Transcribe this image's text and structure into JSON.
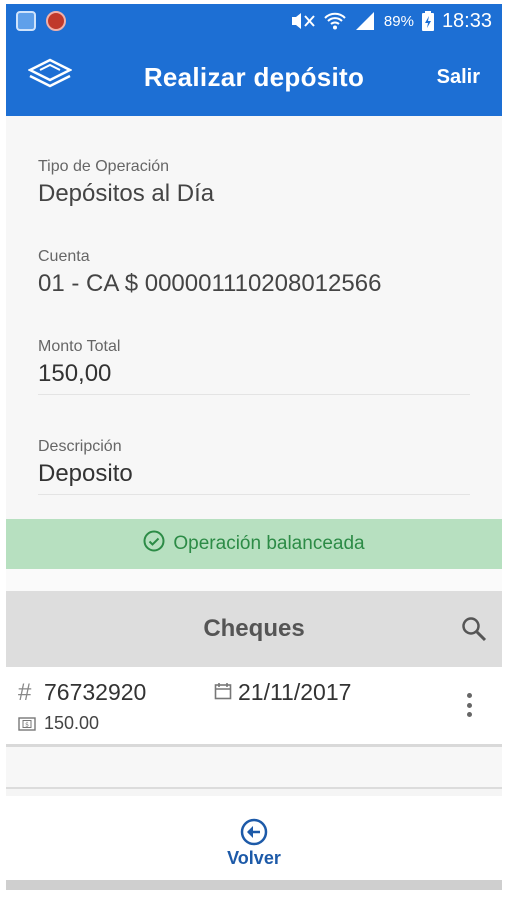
{
  "status_bar": {
    "battery": "89%",
    "time": "18:33",
    "icons": [
      "app-icon",
      "app-icon-2",
      "mute-icon",
      "wifi-icon",
      "signal-icon",
      "battery-icon"
    ]
  },
  "app_bar": {
    "title": "Realizar depósito",
    "exit_label": "Salir",
    "logo_icon": "bank-logo-icon"
  },
  "form": {
    "operation_type": {
      "label": "Tipo de Operación",
      "value": "Depósitos al Día"
    },
    "account": {
      "label": "Cuenta",
      "value": "01 - CA $ 000001110208012566"
    },
    "total_amount": {
      "label": "Monto Total",
      "value": "150,00"
    },
    "description": {
      "label": "Descripción",
      "value": "Deposito"
    }
  },
  "status_banner": {
    "text": "Operación balanceada",
    "color": "#2c8b46",
    "background": "#b7e0c0"
  },
  "checks": {
    "title": "Cheques",
    "items": [
      {
        "hash_symbol": "#",
        "number": "76732920",
        "date": "21/11/2017",
        "amount": "150.00"
      }
    ]
  },
  "footer": {
    "back_label": "Volver"
  },
  "colors": {
    "primary": "#1d6fd4",
    "link": "#1d5aa8"
  }
}
